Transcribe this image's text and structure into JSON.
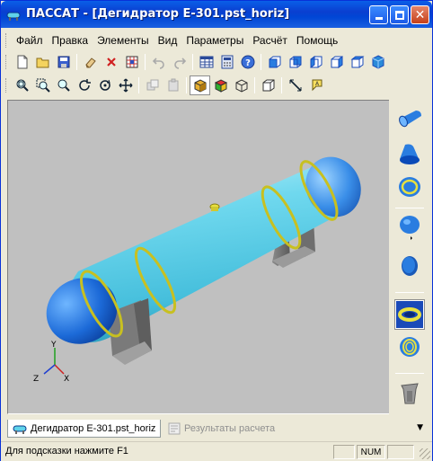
{
  "window": {
    "title": "ПАССАТ - [Дегидратор Е-301.pst_horiz]",
    "buttons": {
      "minimize": "minimize-icon",
      "maximize": "maximize-icon",
      "close": "close-icon"
    }
  },
  "menu": {
    "items": [
      {
        "label": "Файл"
      },
      {
        "label": "Правка"
      },
      {
        "label": "Элементы"
      },
      {
        "label": "Вид"
      },
      {
        "label": "Параметры"
      },
      {
        "label": "Расчёт"
      },
      {
        "label": "Помощь"
      }
    ]
  },
  "toolbar1": {
    "icons": [
      "new-file-icon",
      "open-folder-icon",
      "save-icon",
      "eraser-icon",
      "delete-icon",
      "grid-icon",
      "undo-icon",
      "redo-icon",
      "table-icon",
      "calculator-icon",
      "help-icon",
      "view-front-icon",
      "view-back-icon",
      "view-left-icon",
      "view-right-icon",
      "view-top-icon",
      "view-iso-icon"
    ]
  },
  "toolbar2": {
    "icons": [
      "zoom-fit-icon",
      "zoom-window-icon",
      "zoom-icon",
      "rotate-icon",
      "rotate-axis-icon",
      "pan-icon",
      "copy-disabled-icon",
      "paste-disabled-icon",
      "shaded-cube-icon",
      "color-cube-icon",
      "wire-cube-icon",
      "box-icon",
      "dimension-icon",
      "label-icon"
    ]
  },
  "viewport": {
    "background": "#c0c0c0",
    "vessel_color": "#5fd3ea",
    "head_color": "#1a6fd6",
    "ring_color": "#c8c020",
    "axes": {
      "y": "Y",
      "z": "Z",
      "x": "X"
    }
  },
  "right_panel": {
    "icons": [
      "cylinder-shell-icon",
      "cone-shell-icon",
      "nozzle-ring-icon",
      "elliptic-head-icon",
      "flat-head-icon",
      "stiffener-ring-icon",
      "flange-icon",
      "saddle-support-icon"
    ]
  },
  "tabs": [
    {
      "label": "Дегидратор Е-301.pst_horiz",
      "active": true
    },
    {
      "label": "Результаты расчета",
      "active": false
    }
  ],
  "status": {
    "hint": "Для подсказки нажмите F1",
    "num": "NUM"
  }
}
